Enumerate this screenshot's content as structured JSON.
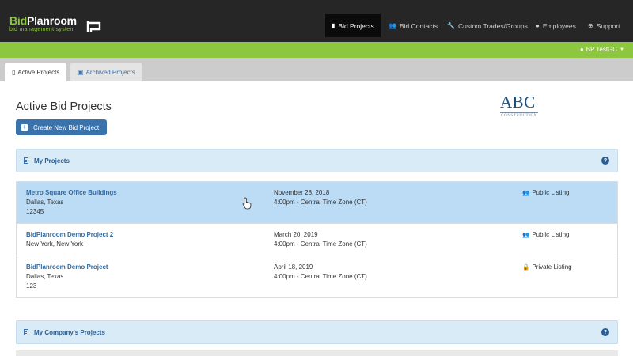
{
  "logo": {
    "brand_bid": "Bid",
    "brand_planroom": "Planroom",
    "tagline": "bid management system"
  },
  "nav": {
    "items": [
      {
        "label": "Bid Projects",
        "icon": "building-icon",
        "active": true
      },
      {
        "label": "Bid Contacts",
        "icon": "users-icon",
        "active": false
      },
      {
        "label": "Custom Trades/Groups",
        "icon": "wrench-icon",
        "active": false
      },
      {
        "label": "Employees",
        "icon": "user-icon",
        "active": false
      },
      {
        "label": "Support",
        "icon": "lifebuoy-icon",
        "active": false
      }
    ]
  },
  "user_menu": {
    "label": "BP TestGC"
  },
  "tabs": [
    {
      "label": "Active Projects",
      "active": true
    },
    {
      "label": "Archived Projects",
      "active": false
    }
  ],
  "main": {
    "title": "Active Bid Projects",
    "create_button": "Create New Bid Project",
    "company_logo": {
      "word": "ABC",
      "sub": "CONSTRUCTION"
    }
  },
  "my_projects": {
    "label": "My Projects",
    "help": "?",
    "rows": [
      {
        "name": "Metro Square Office Buildings",
        "location": "Dallas, Texas",
        "extra": "12345",
        "date": "November 28, 2018",
        "time": "4:00pm - Central Time Zone (CT)",
        "listing": "Public Listing",
        "listing_icon": "users-icon"
      },
      {
        "name": "BidPlanroom Demo Project 2",
        "location": "New York, New York",
        "extra": "",
        "date": "March 20, 2019",
        "time": "4:00pm - Central Time Zone (CT)",
        "listing": "Public Listing",
        "listing_icon": "users-icon"
      },
      {
        "name": "BidPlanroom Demo Project",
        "location": "Dallas, Texas",
        "extra": "123",
        "date": "April 18, 2019",
        "time": "4:00pm - Central Time Zone (CT)",
        "listing": "Private Listing",
        "listing_icon": "lock-icon"
      }
    ]
  },
  "company_projects": {
    "label": "My Company's Projects",
    "help": "?"
  },
  "colors": {
    "topbar": "#262626",
    "brand_green": "#8dc63f",
    "link_blue": "#2f6aa3",
    "button_blue": "#3a72ab",
    "panel_head_bg": "#d9ebf7",
    "row_highlight": "#bcdcf5"
  }
}
